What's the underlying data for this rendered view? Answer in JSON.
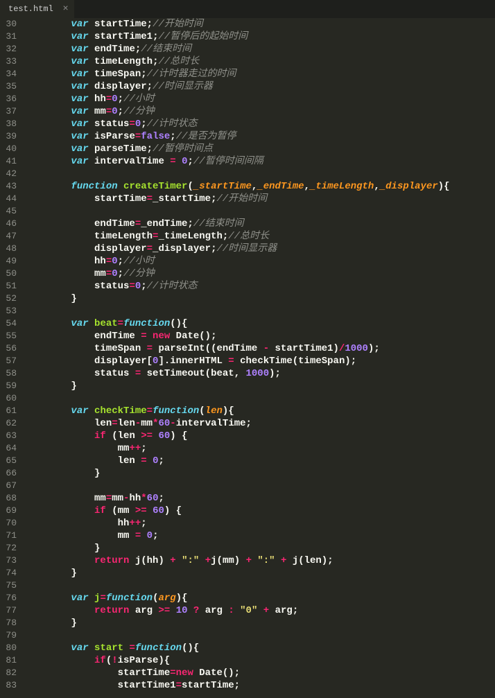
{
  "tab": {
    "filename": "test.html",
    "close": "×"
  },
  "lines": {
    "start": 30,
    "end": 83
  },
  "code": {
    "l30": {
      "kw": "var",
      "name": "startTime",
      "cm": "//开始时间"
    },
    "l31": {
      "kw": "var",
      "name": "startTime1",
      "cm": "//暂停后的起始时间"
    },
    "l32": {
      "kw": "var",
      "name": "endTime",
      "cm": "//结束时间"
    },
    "l33": {
      "kw": "var",
      "name": "timeLength",
      "cm": "//总时长"
    },
    "l34": {
      "kw": "var",
      "name": "timeSpan",
      "cm": "//计时器走过的时间"
    },
    "l35": {
      "kw": "var",
      "name": "displayer",
      "cm": "//时间显示器"
    },
    "l36": {
      "kw": "var",
      "name": "hh",
      "val": "0",
      "cm": "//小时"
    },
    "l37": {
      "kw": "var",
      "name": "mm",
      "val": "0",
      "cm": "//分钟"
    },
    "l38": {
      "kw": "var",
      "name": "status",
      "val": "0",
      "cm": "//计时状态"
    },
    "l39": {
      "kw": "var",
      "name": "isParse",
      "val": "false",
      "cm": "//是否为暂停"
    },
    "l40": {
      "kw": "var",
      "name": "parseTime",
      "cm": "//暂停时间点"
    },
    "l41": {
      "kw": "var",
      "name": "intervalTime",
      "val": "0",
      "cm": "//暂停时间间隔"
    },
    "l43": {
      "kw": "function",
      "fn": "createTimer",
      "a1": "_startTime",
      "a2": "_endTime",
      "a3": "_timeLength",
      "a4": "_displayer"
    },
    "l44": {
      "lhs": "startTime",
      "rhs": "_startTime",
      "cm": "//开始时间"
    },
    "l46": {
      "lhs": "endTime",
      "rhs": "_endTime",
      "cm": "//结束时间"
    },
    "l47": {
      "lhs": "timeLength",
      "rhs": "_timeLength",
      "cm": "//总时长"
    },
    "l48": {
      "lhs": "displayer",
      "rhs": "_displayer",
      "cm": "//时间显示器"
    },
    "l49": {
      "lhs": "hh",
      "val": "0",
      "cm": "//小时"
    },
    "l50": {
      "lhs": "mm",
      "val": "0",
      "cm": "//分钟"
    },
    "l51": {
      "lhs": "status",
      "val": "0",
      "cm": "//计时状态"
    },
    "l54": {
      "kw": "var",
      "name": "beat",
      "fn": "function"
    },
    "l55": {
      "lhs": "endTime",
      "kw": "new",
      "cls": "Date"
    },
    "l56": {
      "lhs": "timeSpan",
      "fn": "parseInt",
      "a": "endTime",
      "b": "startTime1",
      "div": "1000"
    },
    "l57": {
      "obj": "displayer",
      "idx": "0",
      "prop": "innerHTML",
      "fn": "checkTime",
      "arg": "timeSpan"
    },
    "l58": {
      "lhs": "status",
      "fn": "setTimeout",
      "a": "beat",
      "b": "1000"
    },
    "l61": {
      "kw": "var",
      "name": "checkTime",
      "fn": "function",
      "arg": "len"
    },
    "l62": {
      "lhs": "len",
      "a": "len",
      "b": "mm",
      "c": "60",
      "d": "intervalTime"
    },
    "l63": {
      "kw": "if",
      "a": "len",
      "op": ">=",
      "b": "60"
    },
    "l64": {
      "v": "mm"
    },
    "l65": {
      "lhs": "len",
      "val": "0"
    },
    "l68": {
      "lhs": "mm",
      "a": "mm",
      "b": "hh",
      "c": "60"
    },
    "l69": {
      "kw": "if",
      "a": "mm",
      "op": ">=",
      "b": "60"
    },
    "l70": {
      "v": "hh"
    },
    "l71": {
      "lhs": "mm",
      "val": "0"
    },
    "l73": {
      "kw": "return",
      "fn": "j",
      "a": "hh",
      "b": "mm",
      "c": "len",
      "s": "\":\""
    },
    "l76": {
      "kw": "var",
      "name": "j",
      "fn": "function",
      "arg": "arg"
    },
    "l77": {
      "kw": "return",
      "a": "arg",
      "op": ">=",
      "b": "10",
      "t": "arg",
      "s": "\"0\"",
      "f": "arg"
    },
    "l80": {
      "kw": "var",
      "name": "start",
      "fn": "function"
    },
    "l81": {
      "kw": "if",
      "neg": "!",
      "a": "isParse"
    },
    "l82": {
      "lhs": "startTime",
      "kw": "new",
      "cls": "Date"
    },
    "l83": {
      "lhs": "startTime1",
      "rhs": "startTime"
    }
  }
}
